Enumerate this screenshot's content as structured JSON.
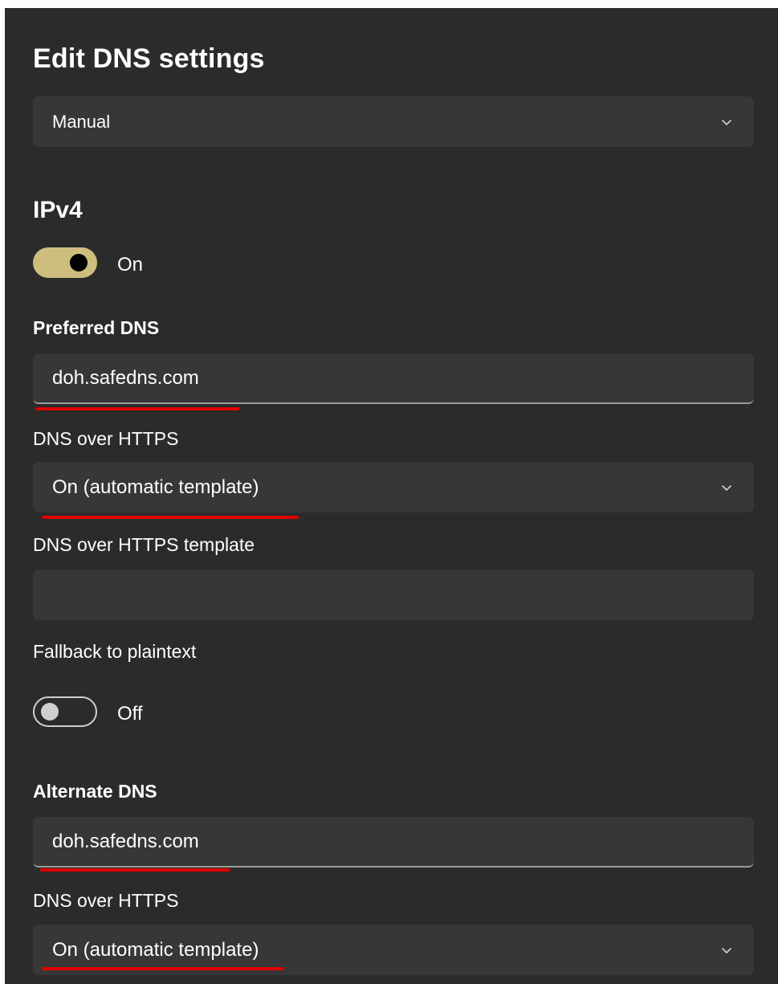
{
  "dialog": {
    "title": "Edit DNS settings",
    "mode_select": {
      "value": "Manual"
    }
  },
  "ipv4": {
    "title": "IPv4",
    "toggle": {
      "state": "On",
      "is_on": true
    }
  },
  "preferred": {
    "label": "Preferred DNS",
    "value": "doh.safedns.com",
    "doh_label": "DNS over HTTPS",
    "doh_select": {
      "value": "On (automatic template)"
    },
    "template_label": "DNS over HTTPS template",
    "template_value": "",
    "fallback_label": "Fallback to plaintext",
    "fallback_toggle": {
      "state": "Off",
      "is_on": false
    }
  },
  "alternate": {
    "label": "Alternate DNS",
    "value": "doh.safedns.com",
    "doh_label": "DNS over HTTPS",
    "doh_select": {
      "value": "On (automatic template)"
    }
  },
  "colors": {
    "background": "#2b2b2b",
    "field": "#373737",
    "accent_toggle": "#cdbe7d",
    "annotation_underline": "#e00000"
  },
  "icons": {
    "dropdown": "chevron-down-icon"
  }
}
